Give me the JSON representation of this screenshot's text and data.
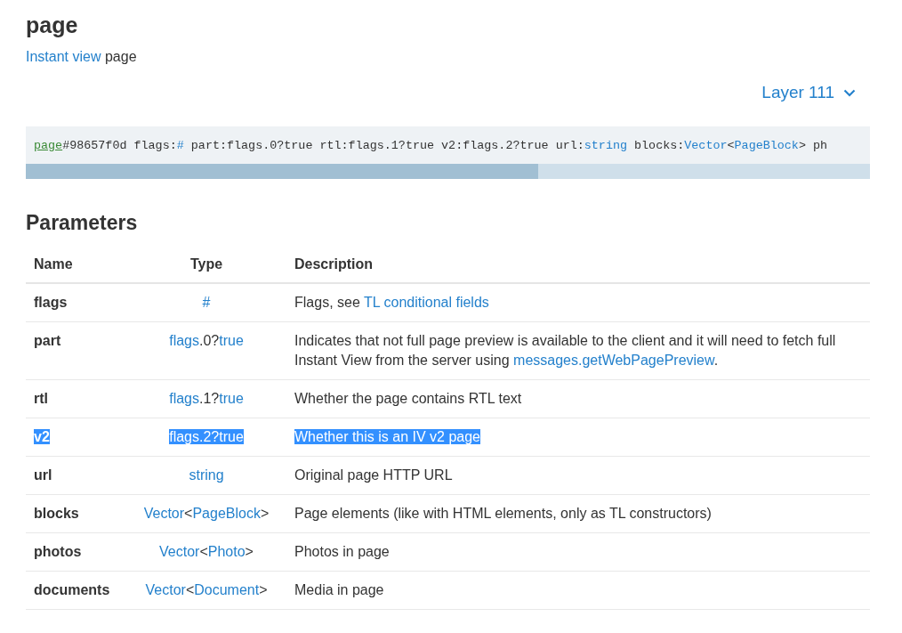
{
  "title": "page",
  "breadcrumb": [
    {
      "text": "Instant view",
      "kind": "link"
    },
    {
      "text": " page",
      "kind": "plain"
    }
  ],
  "layer_selector": {
    "label": "Layer 111"
  },
  "constructor_line": [
    {
      "text": "page",
      "kind": "visited"
    },
    {
      "text": "#98657f0d flags:",
      "kind": "plain"
    },
    {
      "text": "#",
      "kind": "link"
    },
    {
      "text": " part:flags.0?true rtl:flags.1?true v2:flags.2?true url:",
      "kind": "plain"
    },
    {
      "text": "string",
      "kind": "link"
    },
    {
      "text": " blocks:",
      "kind": "plain"
    },
    {
      "text": "Vector",
      "kind": "link"
    },
    {
      "text": "<",
      "kind": "plain"
    },
    {
      "text": "PageBlock",
      "kind": "link"
    },
    {
      "text": "> ph",
      "kind": "plain"
    }
  ],
  "parameters": {
    "heading": "Parameters",
    "columns": [
      "Name",
      "Type",
      "Description"
    ],
    "rows": [
      {
        "name": "flags",
        "selected": false,
        "type": [
          {
            "text": "#",
            "kind": "link"
          }
        ],
        "description": [
          {
            "text": "Flags, see ",
            "kind": "plain"
          },
          {
            "text": "TL conditional fields",
            "kind": "link"
          }
        ]
      },
      {
        "name": "part",
        "selected": false,
        "type": [
          {
            "text": "flags",
            "kind": "link"
          },
          {
            "text": ".0?",
            "kind": "plain"
          },
          {
            "text": "true",
            "kind": "link"
          }
        ],
        "description": [
          {
            "text": "Indicates that not full page preview is available to the client and it will need to fetch full Instant View from the server using ",
            "kind": "plain"
          },
          {
            "text": "messages.getWebPagePreview",
            "kind": "link"
          },
          {
            "text": ".",
            "kind": "plain"
          }
        ]
      },
      {
        "name": "rtl",
        "selected": false,
        "type": [
          {
            "text": "flags",
            "kind": "link"
          },
          {
            "text": ".1?",
            "kind": "plain"
          },
          {
            "text": "true",
            "kind": "link"
          }
        ],
        "description": [
          {
            "text": "Whether the page contains RTL text",
            "kind": "plain"
          }
        ]
      },
      {
        "name": "v2",
        "selected": true,
        "type": [
          {
            "text": "flags",
            "kind": "link"
          },
          {
            "text": ".2?",
            "kind": "plain"
          },
          {
            "text": "true",
            "kind": "link"
          }
        ],
        "description": [
          {
            "text": "Whether this is an IV v2 page",
            "kind": "plain"
          }
        ]
      },
      {
        "name": "url",
        "selected": false,
        "type": [
          {
            "text": "string",
            "kind": "link"
          }
        ],
        "description": [
          {
            "text": "Original page HTTP URL",
            "kind": "plain"
          }
        ]
      },
      {
        "name": "blocks",
        "selected": false,
        "type": [
          {
            "text": "Vector",
            "kind": "link"
          },
          {
            "text": "<",
            "kind": "plain"
          },
          {
            "text": "PageBlock",
            "kind": "link"
          },
          {
            "text": ">",
            "kind": "plain"
          }
        ],
        "description": [
          {
            "text": "Page elements (like with HTML elements, only as TL constructors)",
            "kind": "plain"
          }
        ]
      },
      {
        "name": "photos",
        "selected": false,
        "type": [
          {
            "text": "Vector",
            "kind": "link"
          },
          {
            "text": "<",
            "kind": "plain"
          },
          {
            "text": "Photo",
            "kind": "link"
          },
          {
            "text": ">",
            "kind": "plain"
          }
        ],
        "description": [
          {
            "text": "Photos in page",
            "kind": "plain"
          }
        ]
      },
      {
        "name": "documents",
        "selected": false,
        "type": [
          {
            "text": "Vector",
            "kind": "link"
          },
          {
            "text": "<",
            "kind": "plain"
          },
          {
            "text": "Document",
            "kind": "link"
          },
          {
            "text": ">",
            "kind": "plain"
          }
        ],
        "description": [
          {
            "text": "Media in page",
            "kind": "plain"
          }
        ]
      }
    ]
  }
}
